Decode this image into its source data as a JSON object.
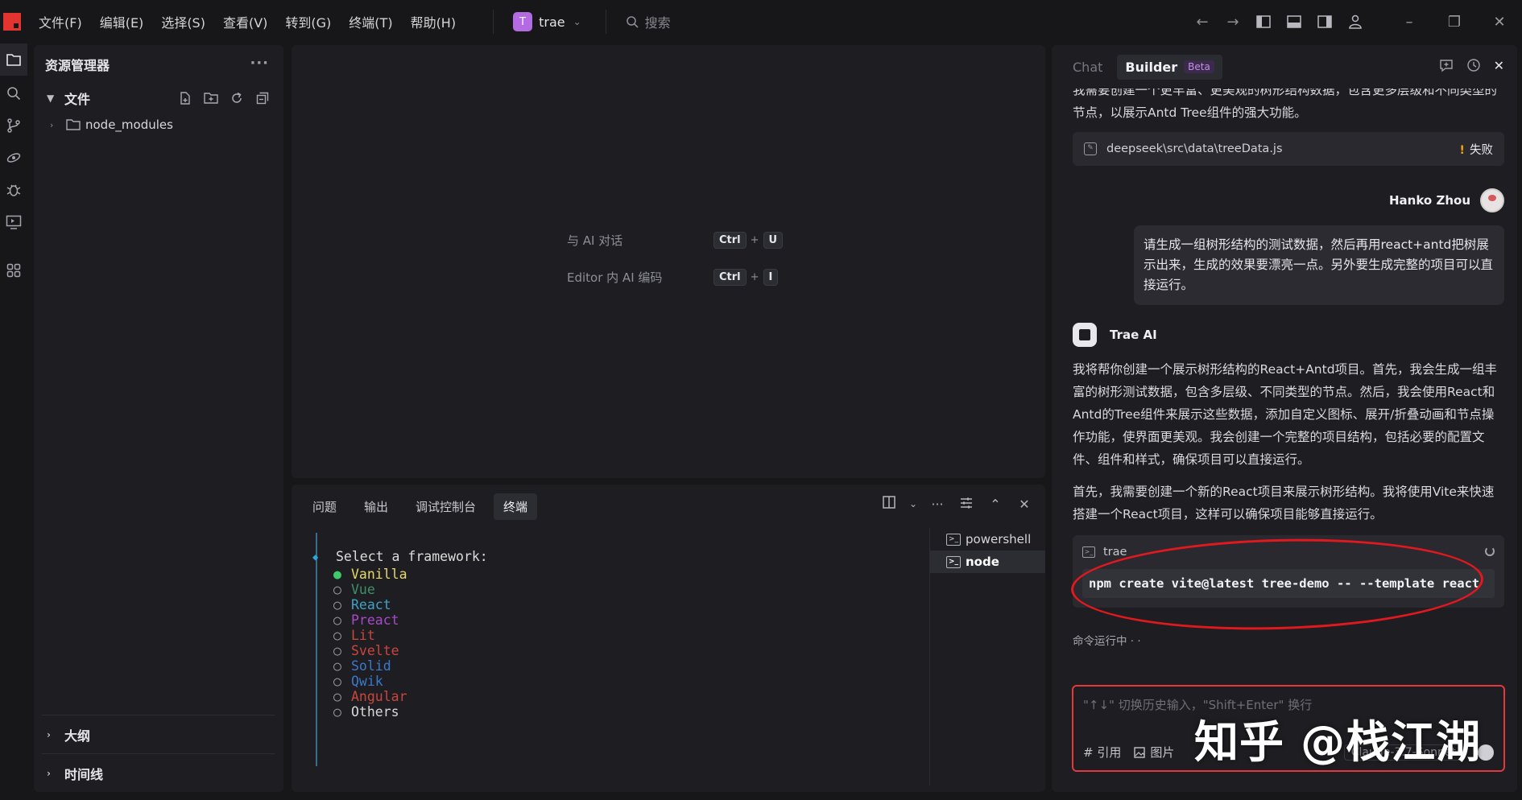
{
  "titlebar": {
    "menus": [
      "文件(F)",
      "编辑(E)",
      "选择(S)",
      "查看(V)",
      "转到(G)",
      "终端(T)",
      "帮助(H)"
    ],
    "project": {
      "avatar_letter": "T",
      "name": "trae"
    },
    "search_placeholder": "搜索",
    "accent": "#e3342f"
  },
  "explorer": {
    "title": "资源管理器",
    "section_files": "文件",
    "tree": [
      {
        "name": "node_modules",
        "type": "folder"
      }
    ],
    "section_outline": "大纲",
    "section_timeline": "时间线"
  },
  "editor": {
    "hints": [
      {
        "label": "与 AI 对话",
        "keys": [
          "Ctrl",
          "U"
        ]
      },
      {
        "label": "Editor 内 AI 编码",
        "keys": [
          "Ctrl",
          "I"
        ]
      }
    ]
  },
  "panel": {
    "tabs": [
      "问题",
      "输出",
      "调试控制台",
      "终端"
    ],
    "active_tab": "终端",
    "terminal": {
      "prompt": "Select a framework:",
      "options": [
        {
          "label": "Vanilla",
          "selected": true,
          "color": "#e5d96b"
        },
        {
          "label": "Vue",
          "selected": false,
          "color": "#3f8f6a"
        },
        {
          "label": "React",
          "selected": false,
          "color": "#3ea3c6"
        },
        {
          "label": "Preact",
          "selected": false,
          "color": "#a64ac9"
        },
        {
          "label": "Lit",
          "selected": false,
          "color": "#c9463d"
        },
        {
          "label": "Svelte",
          "selected": false,
          "color": "#c9463d"
        },
        {
          "label": "Solid",
          "selected": false,
          "color": "#3b78c9"
        },
        {
          "label": "Qwik",
          "selected": false,
          "color": "#3b78c9"
        },
        {
          "label": "Angular",
          "selected": false,
          "color": "#c9463d"
        },
        {
          "label": "Others",
          "selected": false,
          "color": "#d8d8d8"
        }
      ]
    },
    "terminal_list": [
      {
        "name": "powershell",
        "active": false
      },
      {
        "name": "node",
        "active": true
      }
    ]
  },
  "chat": {
    "tabs": {
      "chat": "Chat",
      "builder": "Builder",
      "beta": "Beta"
    },
    "intro_text": "我需要创建一个更丰富、更美观的树形结构数据，包含更多层级和不同类型的节点，以展示Antd Tree组件的强大功能。",
    "file_card": {
      "path": "deepseek\\src\\data\\treeData.js",
      "status": "失败"
    },
    "user": {
      "name": "Hanko Zhou",
      "message": "请生成一组树形结构的测试数据，然后再用react+antd把树展示出来，生成的效果要漂亮一点。另外要生成完整的项目可以直接运行。"
    },
    "ai": {
      "name": "Trae AI",
      "para1": "我将帮你创建一个展示树形结构的React+Antd项目。首先，我会生成一组丰富的树形测试数据，包含多层级、不同类型的节点。然后，我会使用React和Antd的Tree组件来展示这些数据，添加自定义图标、展开/折叠动画和节点操作功能，使界面更美观。我会创建一个完整的项目结构，包括必要的配置文件、组件和样式，确保项目可以直接运行。",
      "para2": "首先，我需要创建一个新的React项目来展示树形结构。我将使用Vite来快速搭建一个React项目，这样可以确保项目能够直接运行。"
    },
    "command": {
      "terminal_name": "trae",
      "code": "npm create vite@latest tree-demo -- --template react"
    },
    "running_text": "命令运行中 · ·",
    "composer": {
      "placeholder": "\"↑↓\" 切换历史输入，\"Shift+Enter\" 换行",
      "ref_label": "# 引用",
      "image_label": "图片",
      "model": "Claude-3.7-Sonnet"
    }
  },
  "watermark": "知乎 @栈江湖"
}
